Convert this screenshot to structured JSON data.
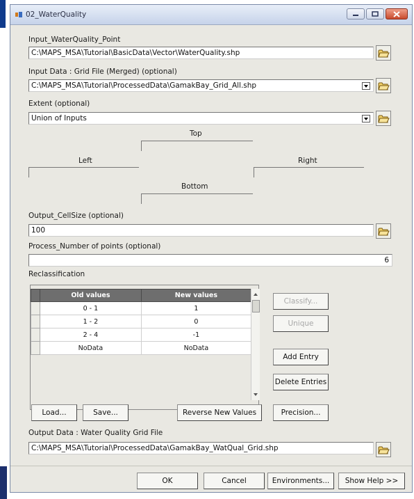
{
  "window": {
    "title": "02_WaterQuality"
  },
  "input_point": {
    "label": "Input_WaterQuality_Point",
    "value": "C:\\MAPS_MSA\\Tutorial\\BasicData\\Vector\\WaterQuality.shp"
  },
  "input_grid": {
    "label": "Input Data : Grid File (Merged) (optional)",
    "value": "C:\\MAPS_MSA\\Tutorial\\ProcessedData\\GamakBay_Grid_All.shp"
  },
  "extent": {
    "label": "Extent (optional)",
    "value": "Union of Inputs",
    "top_label": "Top",
    "left_label": "Left",
    "right_label": "Right",
    "bottom_label": "Bottom"
  },
  "cellsize": {
    "label": "Output_CellSize (optional)",
    "value": "100"
  },
  "points": {
    "label": "Process_Number of points (optional)",
    "value": "6"
  },
  "reclass": {
    "label": "Reclassification",
    "columns": [
      "Old values",
      "New values"
    ],
    "rows": [
      {
        "old": "0 - 1",
        "new": "1"
      },
      {
        "old": "1 - 2",
        "new": "0"
      },
      {
        "old": "2 - 4",
        "new": "-1"
      },
      {
        "old": "NoData",
        "new": "NoData"
      }
    ],
    "buttons": {
      "classify": "Classify...",
      "unique": "Unique",
      "add_entry": "Add Entry",
      "delete_entries": "Delete Entries",
      "load": "Load...",
      "save": "Save...",
      "reverse": "Reverse New Values",
      "precision": "Precision..."
    }
  },
  "output": {
    "label": "Output Data : Water Quality Grid File",
    "value": "C:\\MAPS_MSA\\Tutorial\\ProcessedData\\GamakBay_WatQual_Grid.shp"
  },
  "footer": {
    "ok": "OK",
    "cancel": "Cancel",
    "environments": "Environments...",
    "help": "Show Help >>"
  }
}
